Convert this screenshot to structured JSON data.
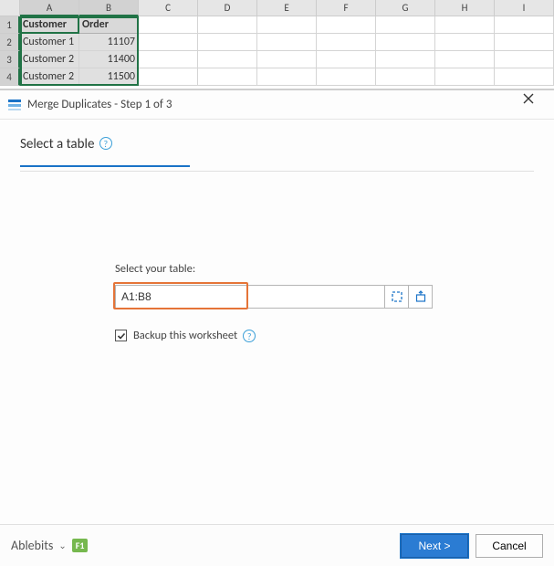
{
  "sheet": {
    "columns": [
      "A",
      "B",
      "C",
      "D",
      "E",
      "F",
      "G",
      "H",
      "I"
    ],
    "rows": [
      {
        "n": "1",
        "a": "Customer",
        "b": "Order"
      },
      {
        "n": "2",
        "a": "Customer 1",
        "b": "11107"
      },
      {
        "n": "3",
        "a": "Customer 2",
        "b": "11400"
      },
      {
        "n": "4",
        "a": "Customer 2",
        "b": "11500"
      }
    ]
  },
  "dialog": {
    "title": "Merge Duplicates - Step 1 of 3",
    "heading": "Select a table",
    "select_label": "Select your table:",
    "range_value": "A1:B8",
    "backup_label": "Backup this worksheet",
    "backup_checked": true,
    "brand": "Ablebits",
    "f1_label": "F1",
    "next_label": "Next >",
    "cancel_label": "Cancel"
  }
}
